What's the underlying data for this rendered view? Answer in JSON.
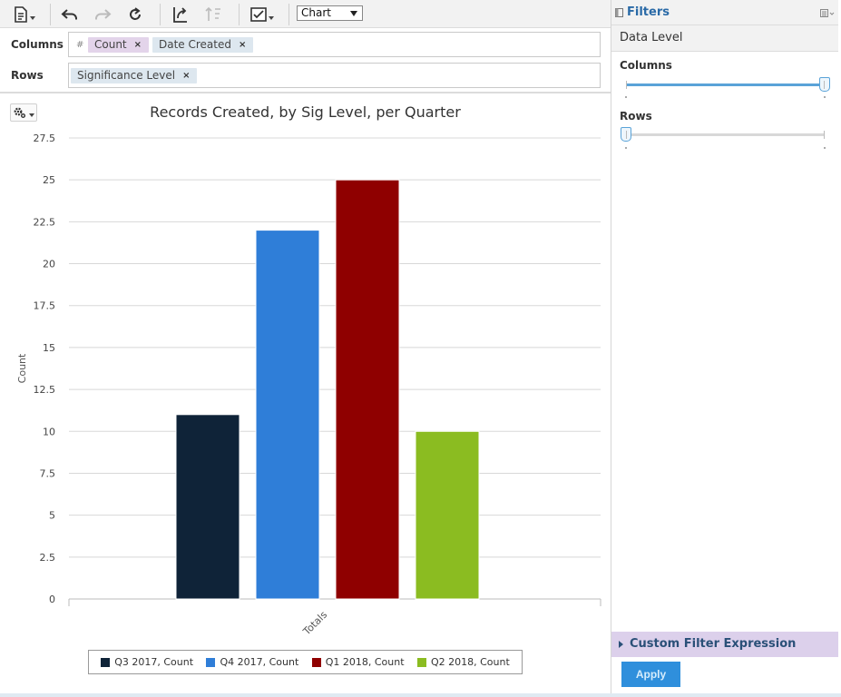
{
  "toolbar": {
    "chart_type_select": "Chart"
  },
  "shelves": {
    "columns_label": "Columns",
    "rows_label": "Rows",
    "columns_measure_symbol": "#",
    "columns_pills": [
      "Count",
      "Date Created"
    ],
    "rows_pills": [
      "Significance Level"
    ],
    "remove_glyph": "×"
  },
  "chart": {
    "title": "Records Created, by Sig Level, per Quarter"
  },
  "chart_data": {
    "type": "bar",
    "title": "Records Created, by Sig Level, per Quarter",
    "xlabel": "",
    "ylabel": "Count",
    "categories": [
      "Totals"
    ],
    "series": [
      {
        "name": "Q3 2017, Count",
        "values": [
          11
        ],
        "color": "#0f2338"
      },
      {
        "name": "Q4 2017, Count",
        "values": [
          22
        ],
        "color": "#2f7ed8"
      },
      {
        "name": "Q1 2018, Count",
        "values": [
          25
        ],
        "color": "#8f0000"
      },
      {
        "name": "Q2 2018, Count",
        "values": [
          10
        ],
        "color": "#8bbc21"
      }
    ],
    "ylim": [
      0,
      27.5
    ],
    "yticks": [
      "0",
      "2.5",
      "5",
      "7.5",
      "10",
      "12.5",
      "15",
      "17.5",
      "20",
      "22.5",
      "25",
      "27.5"
    ],
    "grid": true,
    "legend_position": "bottom"
  },
  "right_panel": {
    "title": "Filters",
    "data_level": "Data Level",
    "columns_slider_label": "Columns",
    "rows_slider_label": "Rows",
    "columns_slider_value": 1.0,
    "rows_slider_value": 0.0,
    "custom_filter_label": "Custom Filter Expression",
    "apply_label": "Apply"
  },
  "colors": {
    "accent": "#2f8fdc",
    "panel_title": "#2a6aa7",
    "custom_filter_bg": "#dcd0eb"
  }
}
